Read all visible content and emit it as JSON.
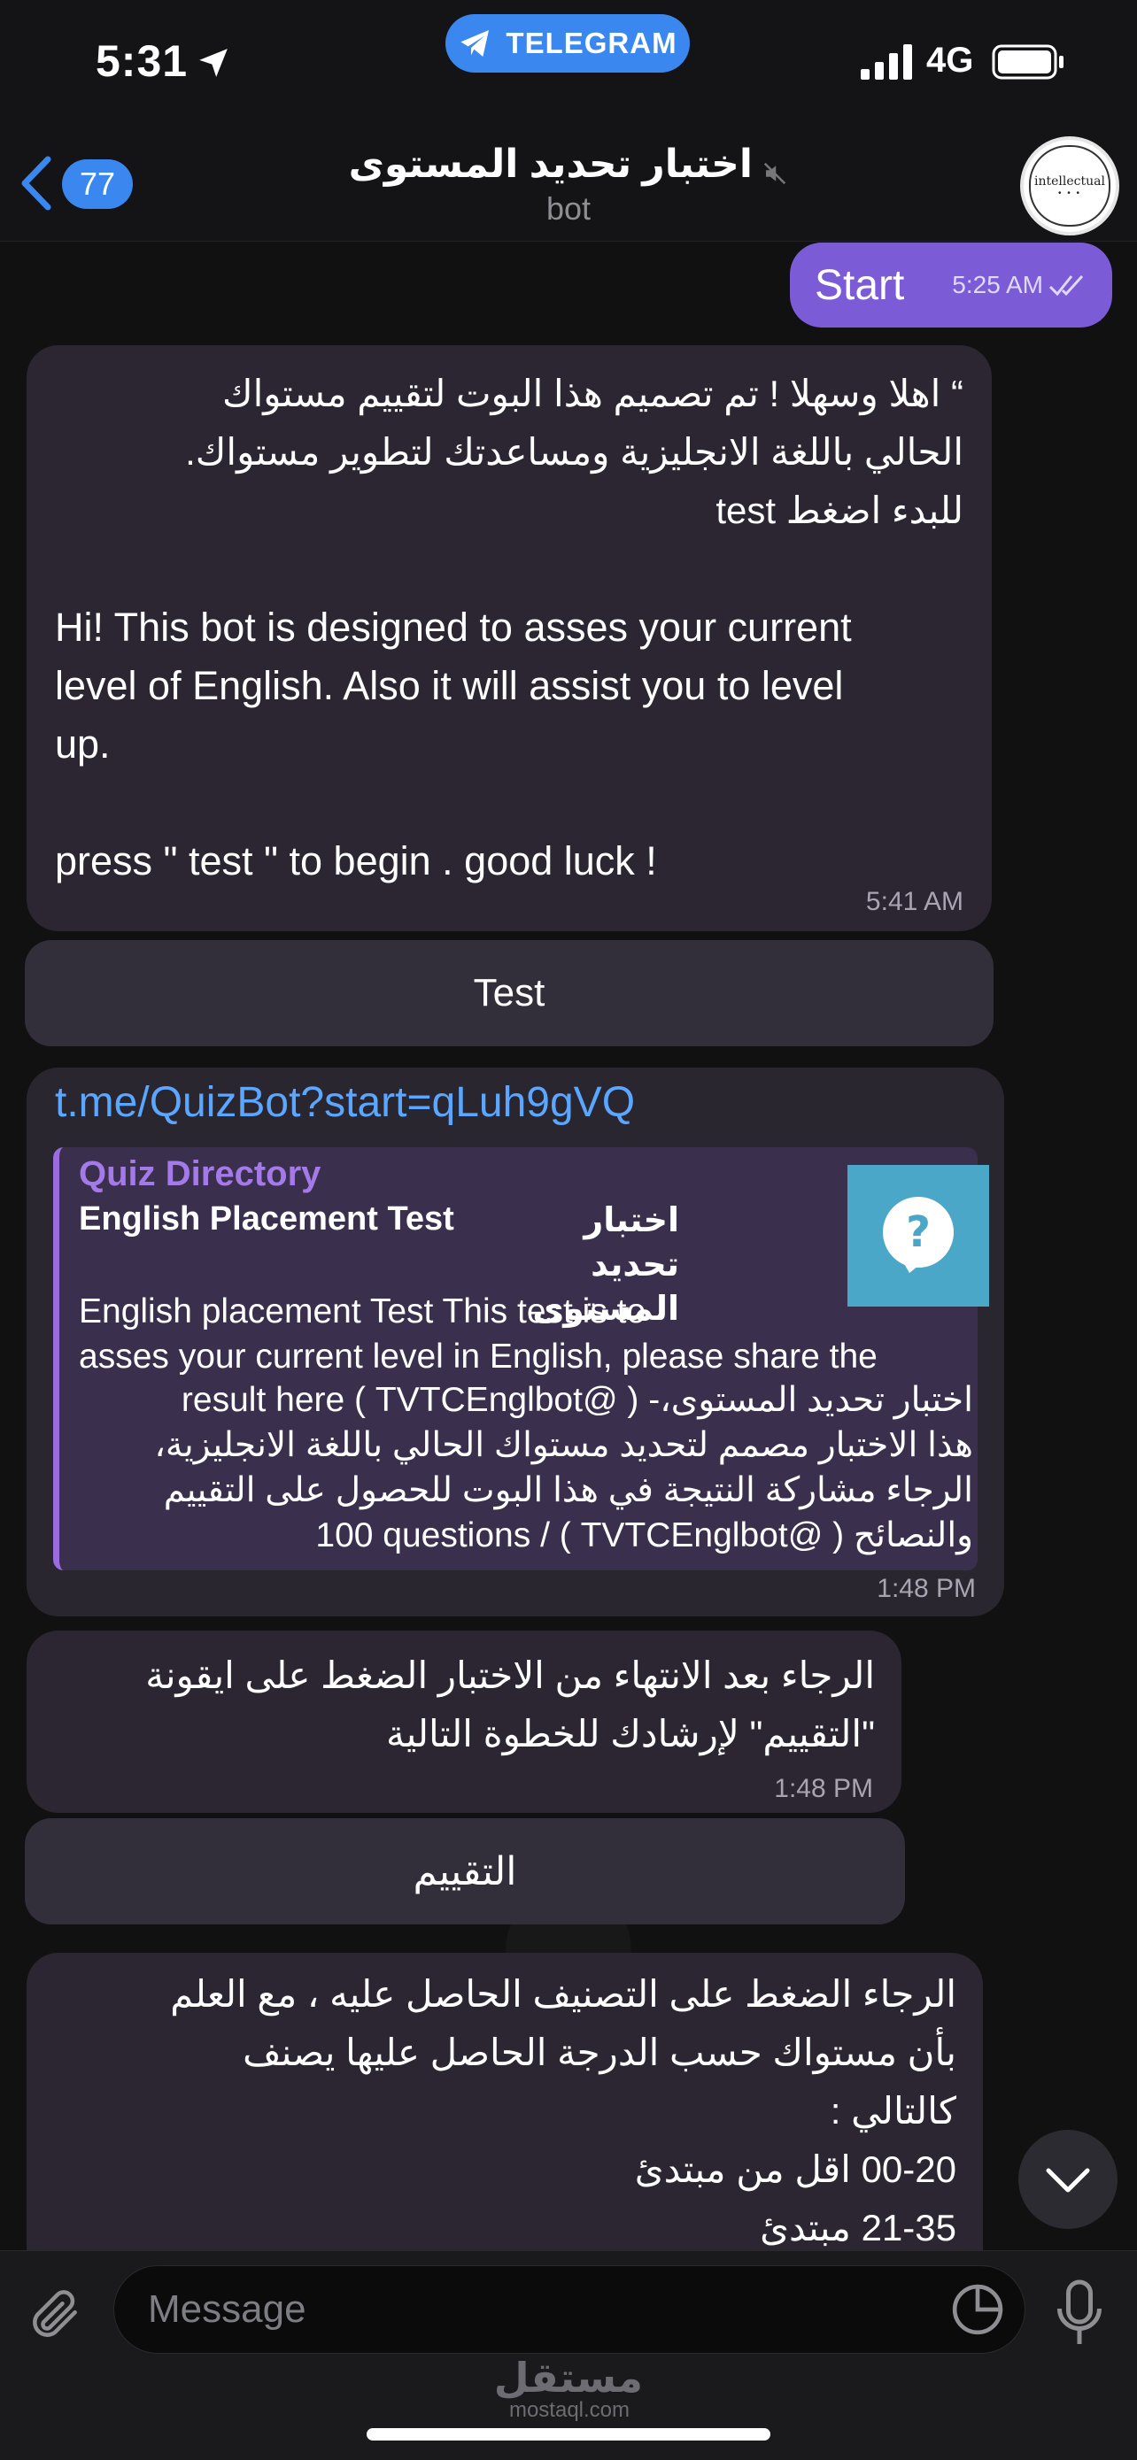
{
  "status_bar": {
    "time": "5:31",
    "app_pill": "TELEGRAM",
    "network": "4G"
  },
  "header": {
    "back_count": "77",
    "title": "اختبار تحديد المستوى",
    "subtitle": "bot",
    "avatar_text": "intellectual"
  },
  "messages": {
    "start": {
      "text": "Start",
      "time": "5:25 AM"
    },
    "welcome": {
      "arabic_lines": [
        "“ اهلا وسهلا ! تم تصميم هذا البوت لتقييم مستواك",
        "الحالي باللغة الانجليزية ومساعدتك لتطوير مستواك.",
        "للبدء اضغط test"
      ],
      "english_lines": [
        "Hi! This bot is designed to asses your current",
        "level of English. Also it will assist you to level",
        "up."
      ],
      "press_line": "press \" test \"  to begin . good luck !",
      "time": "5:41 AM"
    },
    "test_button": "Test",
    "quiz_link": {
      "url": "t.me/QuizBot?start=qLuh9gVQ",
      "site": "Quiz Directory",
      "title": "English Placement Test",
      "title_ar": "اختبار تحديد المستوى",
      "desc_en_lines": [
        "English placement Test  This test is to",
        "asses your current level in English, please share the"
      ],
      "desc_ar_lines": [
        "اختبار تحديد المستوى،- ( @TVTCEnglbot )  result here",
        "هذا الاختبار مصمم لتحديد مستواك الحالي باللغة الانجليزية،",
        "الرجاء مشاركة النتيجة في هذا البوت للحصول على التقييم",
        "والنصائح  ( @TVTCEnglbot )  /  100 questions"
      ],
      "time": "1:48 PM"
    },
    "after_quiz": {
      "lines": [
        "الرجاء بعد الانتهاء من الاختبار الضغط على ايقونة",
        "\"التقييم\" لإرشادك للخطوة التالية"
      ],
      "time": "1:48 PM"
    },
    "rating_button": "التقييم",
    "classification": {
      "lines": [
        "الرجاء الضغط على التصنيف الحاصل عليه ، مع العلم",
        "بأن مستواك حسب الدرجة الحاصل عليها يصنف",
        "كالتالي :",
        "00-20 اقل من مبتدئ",
        "21-35 مبتدئ"
      ]
    }
  },
  "input": {
    "placeholder": "Message"
  },
  "watermark": {
    "arabic": "مستقل",
    "latin": "mostaql.com"
  },
  "colors": {
    "outgoing": "#7b5bd6",
    "incoming": "#2b2631",
    "accent": "#3a87f0",
    "link": "#5ba6ff"
  }
}
